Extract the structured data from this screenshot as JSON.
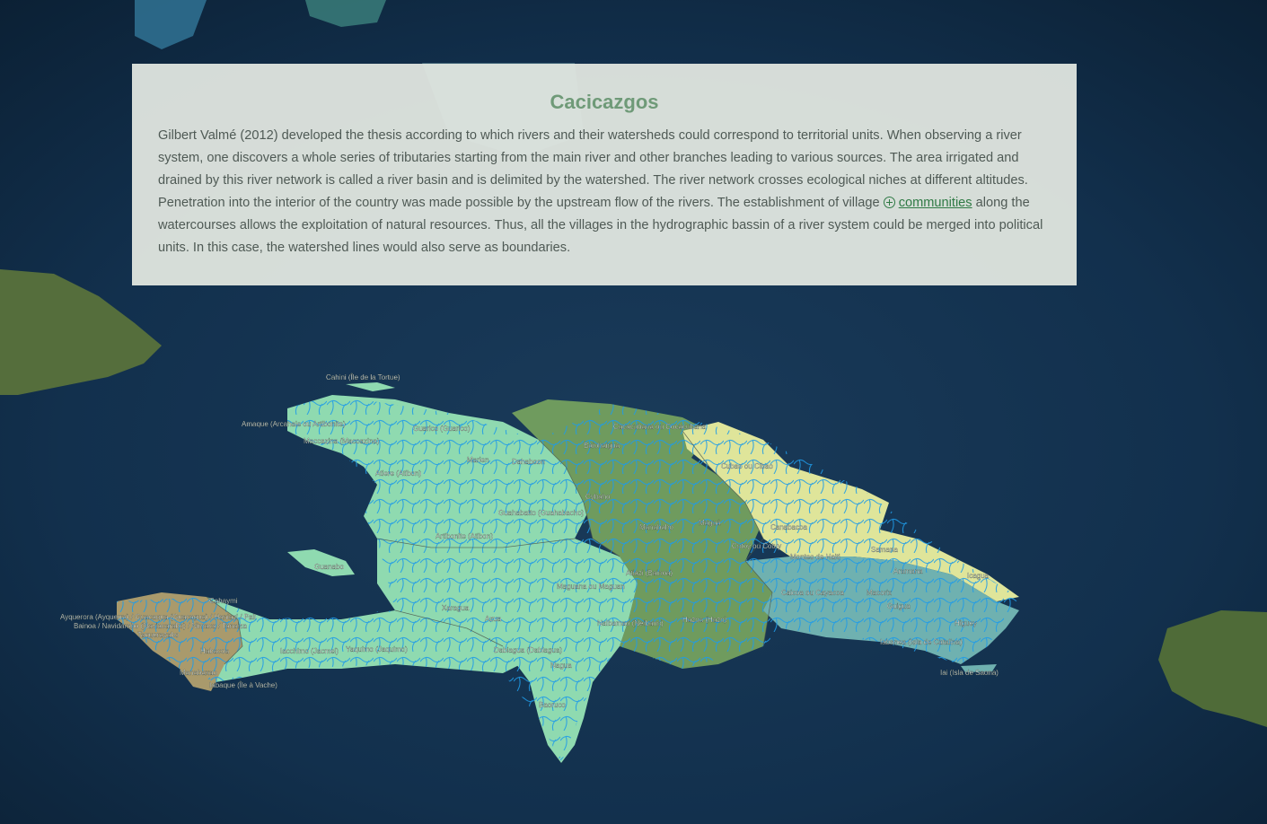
{
  "panel": {
    "title": "Cacicazgos",
    "text_before": "Gilbert Valmé (2012) developed the thesis according to which rivers and their watersheds could correspond to territorial units. When observing a river system, one discovers a whole series of tributaries starting from the main river and other branches leading to various sources. The area irrigated and drained by this river network is called a river basin and is delimited by the watershed. The river network crosses ecological niches at different altitudes. Penetration into the interior of the country was made possible by the upstream flow of the rivers. The establishment of village ",
    "link_label": "communities",
    "link_icon": "plus-circle-icon",
    "text_after": " along the watercourses allows the exploitation of natural resources. Thus, all the villages in the hydrographic bassin of a river system could be merged into political units. In this case, the watershed lines would also serve as boundaries."
  },
  "map": {
    "colors": {
      "ocean": "#12304d",
      "marien": "#8fdab0",
      "magua": "#6f9b5e",
      "maguana": "#8fdab0",
      "xaragua": "#8fdab0",
      "higuey": "#6fb1b0",
      "cibao_north": "#dfe59a",
      "southwest_tip": "#a99a6c",
      "rivers": "#1e9be8"
    },
    "labels": {
      "cahini": "Cahini (Île de la Tortue)",
      "amaque": "Amaque (Arcahaie ou Artibonite)",
      "guarico": "Guarico (Guarico)",
      "maccazina": "Maccazina (Macoazina)",
      "marien": "Marien",
      "dahaboon": "Dahaboon",
      "baiohaigua": "Baiohaigua",
      "cacacubana": "Cacacubana ou Cocacubana",
      "cubao": "Cubao ou Cibao",
      "atiere": "Atiere (Atibon)",
      "cybaho": "Cybaho",
      "guahabatto": "Guahabatto (Guahabacho)",
      "manabaho": "Manabaho",
      "magua": "Maguá",
      "canabacoa": "Canabacoa",
      "artibonite": "Artibonite (Atibon)",
      "cotoy": "Cotoy ou Cotuy",
      "samana": "Samana",
      "montes": "Montes de Haiti",
      "xaragua_isl": "Guanabo",
      "azuei": "Atiazi (Bainoa)",
      "maguana": "Maguana ou Maguan",
      "caicoa": "Caicoa ou Cayacoa",
      "macorix": "Macorix",
      "aramana": "Aramana",
      "icagua": "Icagua",
      "guigua": "Guigua",
      "cahaymi": "Cahaymi",
      "ayquerora": "Ayquerora (Ayquerra) / Guacaqua (Guacagua) / Haniazi / Pali",
      "bainoa": "Bainoa / Navidarabo (Naviacarabo) / Nimaca / Tanaiza",
      "taquerazabo": "Taquerazabo",
      "xaragua": "Xaragua",
      "azua": "Azua",
      "neyba": "Nalbamao (Neibano)",
      "hazoa": "Hazoa (Hazo)",
      "higuey": "Higuey",
      "habacoa": "Habacoa",
      "iacchimo": "Iacchimo (Jacmel)",
      "yaquimo": "Yaquimo (Jaquimo)",
      "dabiagua": "Dabiagua (Dabiagua)",
      "nagua": "Nagua",
      "manabaxao": "Manabaxao",
      "iabaque": "Iabaque (Île à Vache)",
      "iabanea": "Iabanea (Isla de Catalina)",
      "saona": "Iai (Isla de Saona)",
      "baoruco": "Baoruco"
    }
  }
}
